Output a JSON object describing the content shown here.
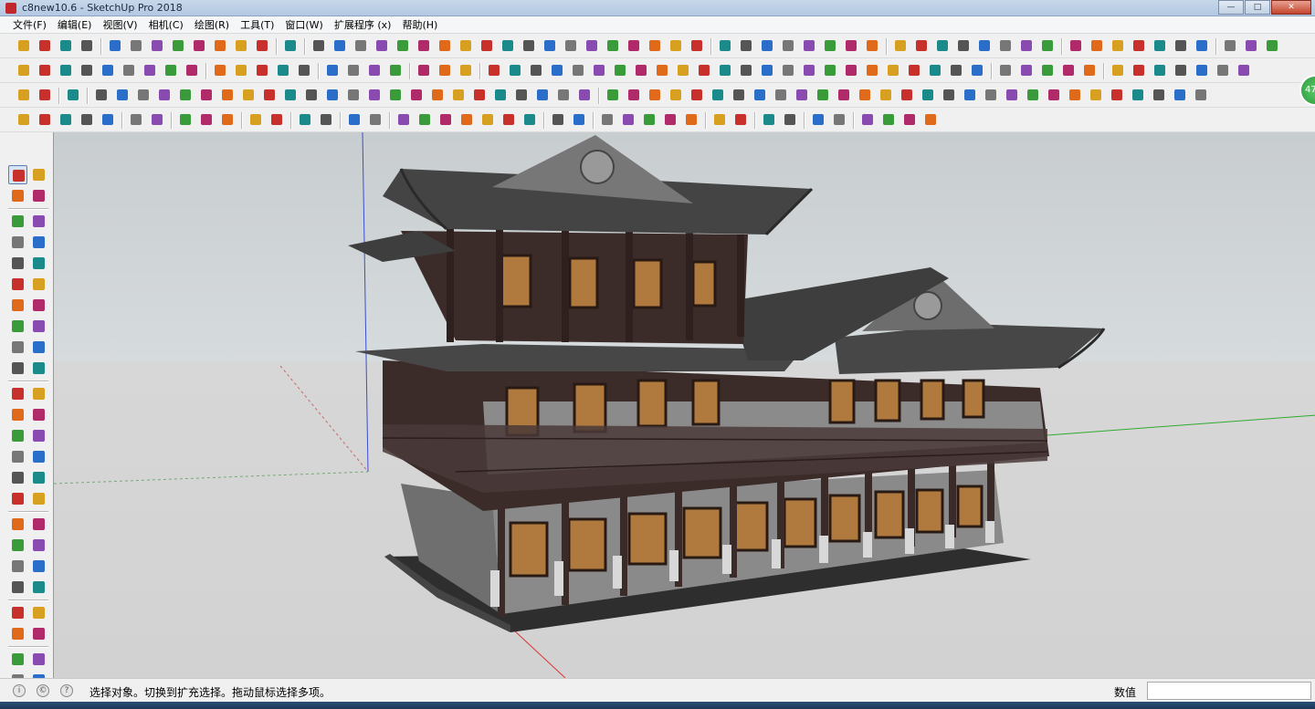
{
  "window": {
    "title": "c8new10.6 - SketchUp Pro 2018",
    "minimize": "—",
    "maximize": "□",
    "close": "✕"
  },
  "menu": [
    {
      "label": "文件(F)"
    },
    {
      "label": "编辑(E)"
    },
    {
      "label": "视图(V)"
    },
    {
      "label": "相机(C)"
    },
    {
      "label": "绘图(R)"
    },
    {
      "label": "工具(T)"
    },
    {
      "label": "窗口(W)"
    },
    {
      "label": "扩展程序 (x)"
    },
    {
      "label": "帮助(H)"
    }
  ],
  "status": {
    "hint": "选择对象。切换到扩充选择。拖动鼠标选择多项。",
    "measurements_label": "数值",
    "measurements_value": "",
    "icon_info": "i",
    "icon_geo": "©",
    "icon_user": "?"
  },
  "badge": {
    "text": "47"
  },
  "colors": {
    "accent": "#2f6fb5",
    "model_dark": "#3a2a28",
    "model_roof": "#4a4a4a",
    "ground": "#d2d2d2",
    "sky": "#c8cdcf"
  }
}
